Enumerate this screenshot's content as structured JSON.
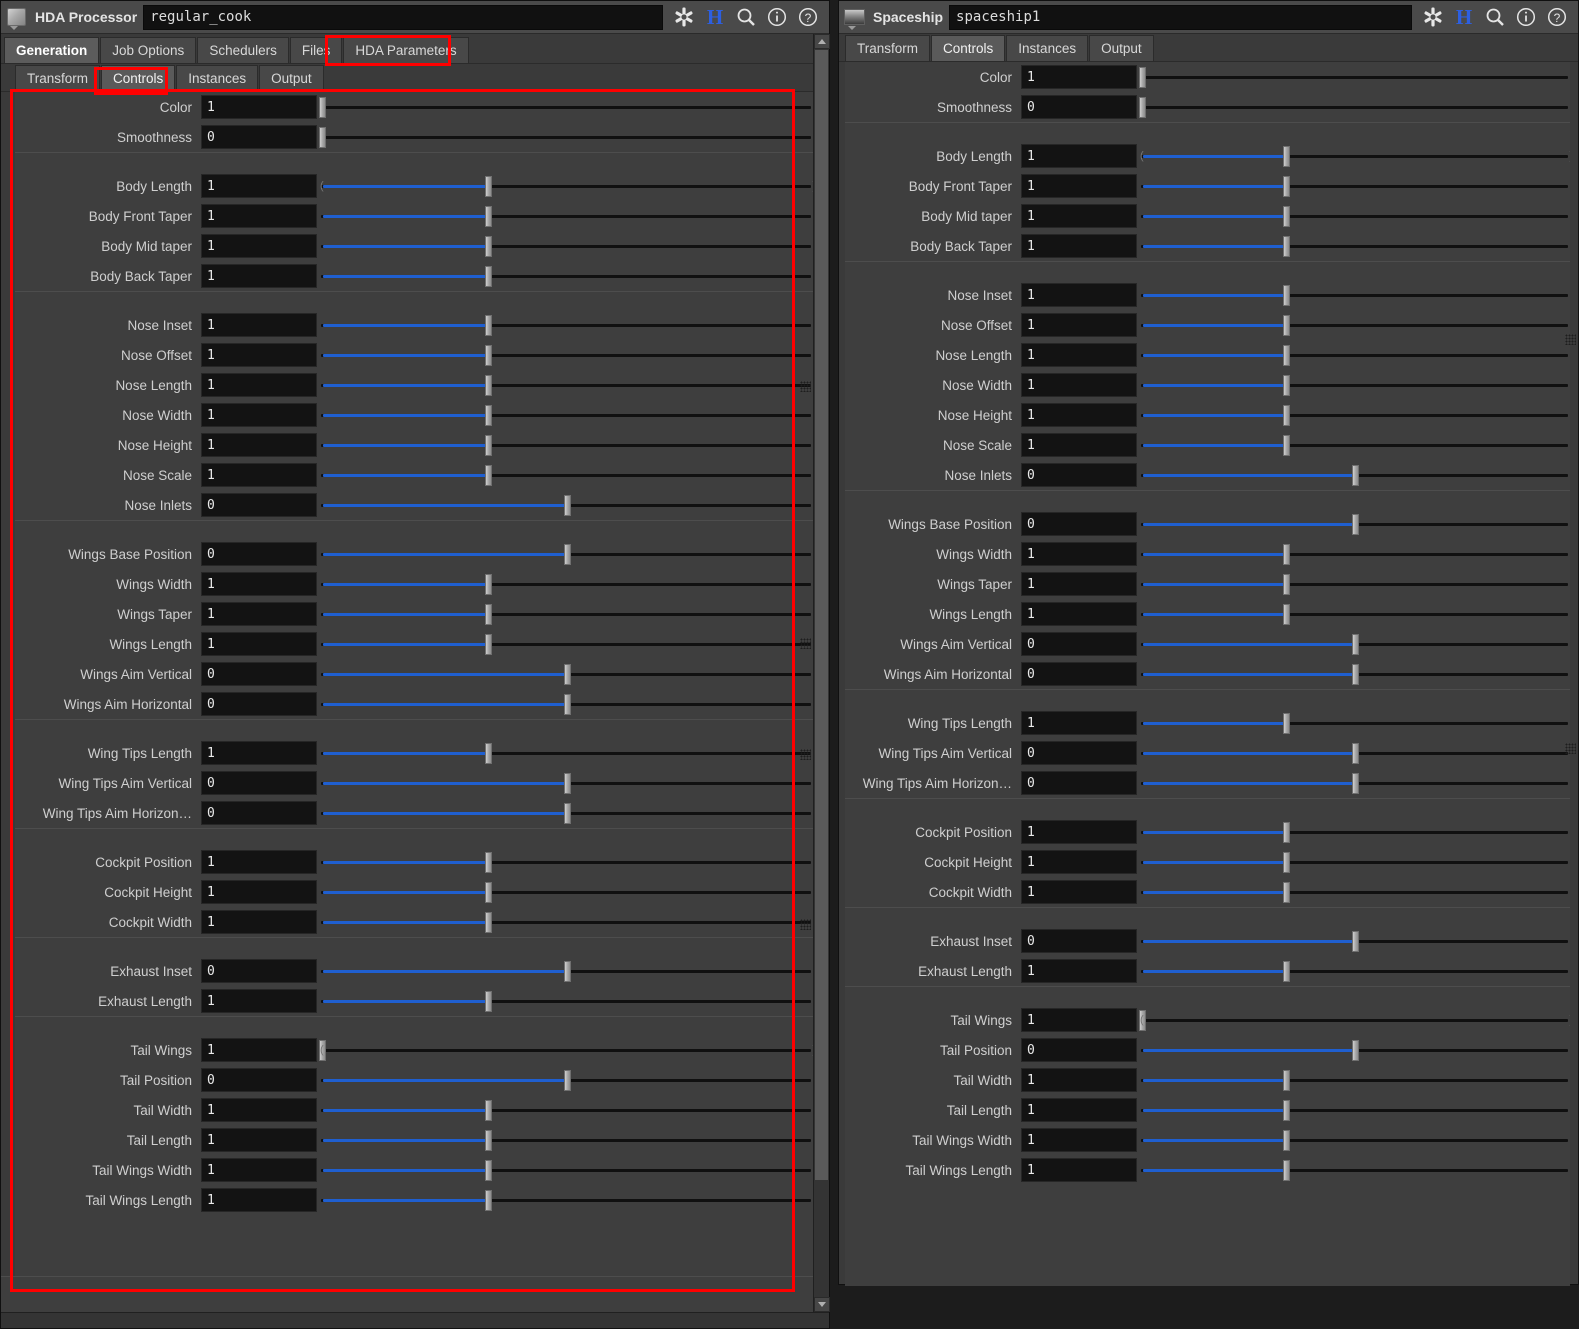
{
  "left_panel": {
    "app_title": "HDA Processor",
    "app_icon": "toolbox-icon",
    "node_name": "regular_cook",
    "titlebar_icons": [
      "gear-icon",
      "houdini-h-icon",
      "search-icon",
      "info-icon",
      "help-icon"
    ],
    "tabs_level1": [
      {
        "label": "Generation",
        "active": true,
        "highlighted": false
      },
      {
        "label": "Job Options",
        "active": false,
        "highlighted": false
      },
      {
        "label": "Schedulers",
        "active": false,
        "highlighted": false
      },
      {
        "label": "Files",
        "active": false,
        "highlighted": false
      },
      {
        "label": "HDA Parameters",
        "active": false,
        "highlighted": true
      }
    ],
    "tabs_level2": [
      {
        "label": "Transform",
        "active": false,
        "highlighted": false
      },
      {
        "label": "Controls",
        "active": true,
        "highlighted": true
      },
      {
        "label": "Instances",
        "active": false,
        "highlighted": false
      },
      {
        "label": "Output",
        "active": false,
        "highlighted": false
      }
    ],
    "groups": [
      {
        "params": [
          {
            "label": "Color",
            "value": "1",
            "slider": "left",
            "pct": 0
          },
          {
            "label": "Smoothness",
            "value": "0",
            "slider": "left",
            "pct": 0
          }
        ]
      },
      {
        "params": [
          {
            "label": "Body Length",
            "value": "1",
            "slider": "fill",
            "pct": 34,
            "endcaps": true
          },
          {
            "label": "Body Front Taper",
            "value": "1",
            "slider": "fill",
            "pct": 34
          },
          {
            "label": "Body Mid taper",
            "value": "1",
            "slider": "fill",
            "pct": 34
          },
          {
            "label": "Body Back Taper",
            "value": "1",
            "slider": "fill",
            "pct": 34
          }
        ]
      },
      {
        "params": [
          {
            "label": "Nose Inset",
            "value": "1",
            "slider": "fill",
            "pct": 34
          },
          {
            "label": "Nose Offset",
            "value": "1",
            "slider": "fill",
            "pct": 34
          },
          {
            "label": "Nose Length",
            "value": "1",
            "slider": "fill",
            "pct": 34
          },
          {
            "label": "Nose Width",
            "value": "1",
            "slider": "fill",
            "pct": 34
          },
          {
            "label": "Nose Height",
            "value": "1",
            "slider": "fill",
            "pct": 34
          },
          {
            "label": "Nose Scale",
            "value": "1",
            "slider": "fill",
            "pct": 34
          },
          {
            "label": "Nose Inlets",
            "value": "0",
            "slider": "fill",
            "pct": 50
          }
        ]
      },
      {
        "params": [
          {
            "label": "Wings Base Position",
            "value": "0",
            "slider": "fill",
            "pct": 50
          },
          {
            "label": "Wings Width",
            "value": "1",
            "slider": "fill",
            "pct": 34
          },
          {
            "label": "Wings Taper",
            "value": "1",
            "slider": "fill",
            "pct": 34
          },
          {
            "label": "Wings Length",
            "value": "1",
            "slider": "fill",
            "pct": 34
          },
          {
            "label": "Wings Aim Vertical",
            "value": "0",
            "slider": "fill",
            "pct": 50
          },
          {
            "label": "Wings Aim Horizontal",
            "value": "0",
            "slider": "fill",
            "pct": 50
          }
        ]
      },
      {
        "params": [
          {
            "label": "Wing Tips Length",
            "value": "1",
            "slider": "fill",
            "pct": 34
          },
          {
            "label": "Wing Tips Aim Vertical",
            "value": "0",
            "slider": "fill",
            "pct": 50
          },
          {
            "label": "Wing Tips Aim Horizon…",
            "value": "0",
            "slider": "fill",
            "pct": 50
          }
        ]
      },
      {
        "params": [
          {
            "label": "Cockpit Position",
            "value": "1",
            "slider": "fill",
            "pct": 34
          },
          {
            "label": "Cockpit Height",
            "value": "1",
            "slider": "fill",
            "pct": 34
          },
          {
            "label": "Cockpit Width",
            "value": "1",
            "slider": "fill",
            "pct": 34
          }
        ]
      },
      {
        "params": [
          {
            "label": "Exhaust Inset",
            "value": "0",
            "slider": "fill",
            "pct": 50
          },
          {
            "label": "Exhaust Length",
            "value": "1",
            "slider": "fill",
            "pct": 34
          }
        ]
      },
      {
        "params": [
          {
            "label": "Tail Wings",
            "value": "1",
            "slider": "left",
            "pct": 0,
            "endcaps": true
          },
          {
            "label": "Tail Position",
            "value": "0",
            "slider": "fill",
            "pct": 50
          },
          {
            "label": "Tail Width",
            "value": "1",
            "slider": "fill",
            "pct": 34
          },
          {
            "label": "Tail Length",
            "value": "1",
            "slider": "fill",
            "pct": 34
          },
          {
            "label": "Tail Wings Width",
            "value": "1",
            "slider": "fill",
            "pct": 34
          },
          {
            "label": "Tail Wings Length",
            "value": "1",
            "slider": "fill",
            "pct": 34
          }
        ]
      }
    ]
  },
  "right_panel": {
    "app_title": "Spaceship",
    "app_icon": "spaceship-icon",
    "node_name": "spaceship1",
    "titlebar_icons": [
      "gear-icon",
      "houdini-h-icon",
      "search-icon",
      "info-icon",
      "help-icon"
    ],
    "tabs": [
      {
        "label": "Transform",
        "active": false
      },
      {
        "label": "Controls",
        "active": true
      },
      {
        "label": "Instances",
        "active": false
      },
      {
        "label": "Output",
        "active": false
      }
    ],
    "groups": [
      {
        "params": [
          {
            "label": "Color",
            "value": "1",
            "slider": "left",
            "pct": 0
          },
          {
            "label": "Smoothness",
            "value": "0",
            "slider": "left",
            "pct": 0
          }
        ]
      },
      {
        "params": [
          {
            "label": "Body Length",
            "value": "1",
            "slider": "fill",
            "pct": 34,
            "endcaps": true
          },
          {
            "label": "Body Front Taper",
            "value": "1",
            "slider": "fill",
            "pct": 34
          },
          {
            "label": "Body Mid taper",
            "value": "1",
            "slider": "fill",
            "pct": 34
          },
          {
            "label": "Body Back Taper",
            "value": "1",
            "slider": "fill",
            "pct": 34
          }
        ]
      },
      {
        "params": [
          {
            "label": "Nose Inset",
            "value": "1",
            "slider": "fill",
            "pct": 34
          },
          {
            "label": "Nose Offset",
            "value": "1",
            "slider": "fill",
            "pct": 34
          },
          {
            "label": "Nose Length",
            "value": "1",
            "slider": "fill",
            "pct": 34
          },
          {
            "label": "Nose Width",
            "value": "1",
            "slider": "fill",
            "pct": 34
          },
          {
            "label": "Nose Height",
            "value": "1",
            "slider": "fill",
            "pct": 34
          },
          {
            "label": "Nose Scale",
            "value": "1",
            "slider": "fill",
            "pct": 34
          },
          {
            "label": "Nose Inlets",
            "value": "0",
            "slider": "fill",
            "pct": 50
          }
        ]
      },
      {
        "params": [
          {
            "label": "Wings Base Position",
            "value": "0",
            "slider": "fill",
            "pct": 50
          },
          {
            "label": "Wings Width",
            "value": "1",
            "slider": "fill",
            "pct": 34
          },
          {
            "label": "Wings Taper",
            "value": "1",
            "slider": "fill",
            "pct": 34
          },
          {
            "label": "Wings Length",
            "value": "1",
            "slider": "fill",
            "pct": 34
          },
          {
            "label": "Wings Aim Vertical",
            "value": "0",
            "slider": "fill",
            "pct": 50
          },
          {
            "label": "Wings Aim Horizontal",
            "value": "0",
            "slider": "fill",
            "pct": 50
          }
        ]
      },
      {
        "params": [
          {
            "label": "Wing Tips Length",
            "value": "1",
            "slider": "fill",
            "pct": 34
          },
          {
            "label": "Wing Tips Aim Vertical",
            "value": "0",
            "slider": "fill",
            "pct": 50
          },
          {
            "label": "Wing Tips Aim Horizon…",
            "value": "0",
            "slider": "fill",
            "pct": 50
          }
        ]
      },
      {
        "params": [
          {
            "label": "Cockpit Position",
            "value": "1",
            "slider": "fill",
            "pct": 34
          },
          {
            "label": "Cockpit Height",
            "value": "1",
            "slider": "fill",
            "pct": 34
          },
          {
            "label": "Cockpit Width",
            "value": "1",
            "slider": "fill",
            "pct": 34
          }
        ]
      },
      {
        "params": [
          {
            "label": "Exhaust Inset",
            "value": "0",
            "slider": "fill",
            "pct": 50
          },
          {
            "label": "Exhaust Length",
            "value": "1",
            "slider": "fill",
            "pct": 34
          }
        ]
      },
      {
        "params": [
          {
            "label": "Tail Wings",
            "value": "1",
            "slider": "left",
            "pct": 0,
            "endcaps": true
          },
          {
            "label": "Tail Position",
            "value": "0",
            "slider": "fill",
            "pct": 50
          },
          {
            "label": "Tail Width",
            "value": "1",
            "slider": "fill",
            "pct": 34
          },
          {
            "label": "Tail Length",
            "value": "1",
            "slider": "fill",
            "pct": 34
          },
          {
            "label": "Tail Wings Width",
            "value": "1",
            "slider": "fill",
            "pct": 34
          },
          {
            "label": "Tail Wings Length",
            "value": "1",
            "slider": "fill",
            "pct": 34
          }
        ]
      }
    ]
  },
  "colors": {
    "slider_fill": "#1f5fd0",
    "annotation": "#ff0000",
    "panel_bg": "#3e3e3e",
    "field_bg": "#131313"
  }
}
